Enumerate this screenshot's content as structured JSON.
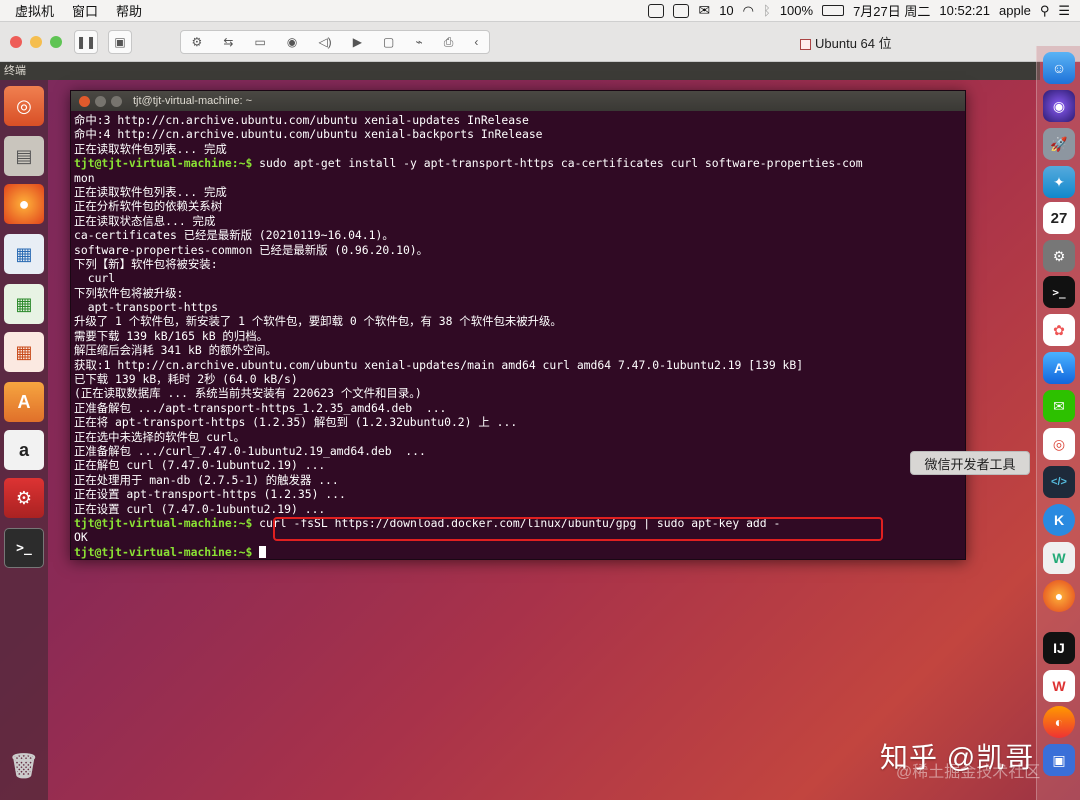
{
  "menubar": {
    "app": "虚拟机",
    "window": "窗口",
    "help": "帮助",
    "wx_count": "10",
    "battery": "100%",
    "date": "7月27日 周二",
    "time": "10:52:21",
    "user": "apple"
  },
  "vm": {
    "title": "Ubuntu 64 位"
  },
  "ubuntu": {
    "topbar": "终端"
  },
  "terminal": {
    "title": "tjt@tjt-virtual-machine: ~",
    "prompt": "tjt@tjt-virtual-machine:~$",
    "lines": [
      {
        "t": "命中:3 http://cn.archive.ubuntu.com/ubuntu xenial-updates InRelease"
      },
      {
        "t": "命中:4 http://cn.archive.ubuntu.com/ubuntu xenial-backports InRelease"
      },
      {
        "t": "正在读取软件包列表... 完成"
      },
      {
        "p": true,
        "t": " sudo apt-get install -y apt-transport-https ca-certificates curl software-properties-com"
      },
      {
        "t": "mon"
      },
      {
        "t": "正在读取软件包列表... 完成"
      },
      {
        "t": "正在分析软件包的依赖关系树"
      },
      {
        "t": "正在读取状态信息... 完成"
      },
      {
        "t": "ca-certificates 已经是最新版 (20210119~16.04.1)。"
      },
      {
        "t": "software-properties-common 已经是最新版 (0.96.20.10)。"
      },
      {
        "t": "下列【新】软件包将被安装:"
      },
      {
        "t": "  curl"
      },
      {
        "t": "下列软件包将被升级:"
      },
      {
        "t": "  apt-transport-https"
      },
      {
        "t": "升级了 1 个软件包，新安装了 1 个软件包，要卸载 0 个软件包，有 38 个软件包未被升级。"
      },
      {
        "t": "需要下载 139 kB/165 kB 的归档。"
      },
      {
        "t": "解压缩后会消耗 341 kB 的额外空间。"
      },
      {
        "t": "获取:1 http://cn.archive.ubuntu.com/ubuntu xenial-updates/main amd64 curl amd64 7.47.0-1ubuntu2.19 [139 kB]"
      },
      {
        "t": "已下载 139 kB，耗时 2秒 (64.0 kB/s)"
      },
      {
        "t": "(正在读取数据库 ... 系统当前共安装有 220623 个文件和目录。)"
      },
      {
        "t": "正准备解包 .../apt-transport-https_1.2.35_amd64.deb  ..."
      },
      {
        "t": "正在将 apt-transport-https (1.2.35) 解包到 (1.2.32ubuntu0.2) 上 ..."
      },
      {
        "t": "正在选中未选择的软件包 curl。"
      },
      {
        "t": "正准备解包 .../curl_7.47.0-1ubuntu2.19_amd64.deb  ..."
      },
      {
        "t": "正在解包 curl (7.47.0-1ubuntu2.19) ..."
      },
      {
        "t": "正在处理用于 man-db (2.7.5-1) 的触发器 ..."
      },
      {
        "t": "正在设置 apt-transport-https (1.2.35) ..."
      },
      {
        "t": "正在设置 curl (7.47.0-1ubuntu2.19) ..."
      },
      {
        "p": true,
        "t": " curl -fsSL https://download.docker.com/linux/ubuntu/gpg | sudo apt-key add -"
      },
      {
        "t": "OK"
      },
      {
        "p": true,
        "t": " ",
        "cursor": true
      }
    ]
  },
  "tooltip": "微信开发者工具",
  "watermark": {
    "main": "知乎 @凯哥",
    "sub": "@稀土掘金技术社区"
  },
  "dock_badges": {
    "calendar": "27"
  }
}
